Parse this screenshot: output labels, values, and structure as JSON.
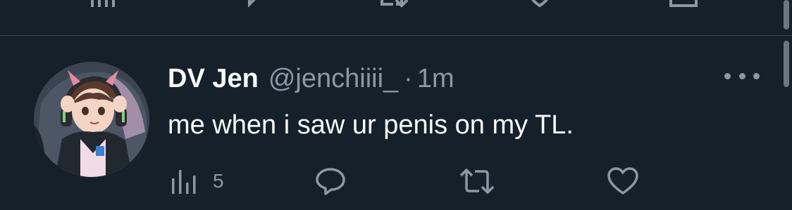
{
  "tweet": {
    "display_name": "DV Jen",
    "handle": "@jenchiiii_",
    "separator": "·",
    "time": "1m",
    "text": "me when i saw ur penis on my TL.",
    "views_count": "5"
  },
  "icons": {
    "views": "bar-chart-icon",
    "reply": "speech-bubble-icon",
    "retweet": "retweet-icon",
    "like": "heart-icon",
    "more": "more-horizontal-icon"
  },
  "colors": {
    "background": "#15202b",
    "text_primary": "#f7f9f9",
    "text_secondary": "#8b98a5",
    "divider": "#38444d"
  }
}
